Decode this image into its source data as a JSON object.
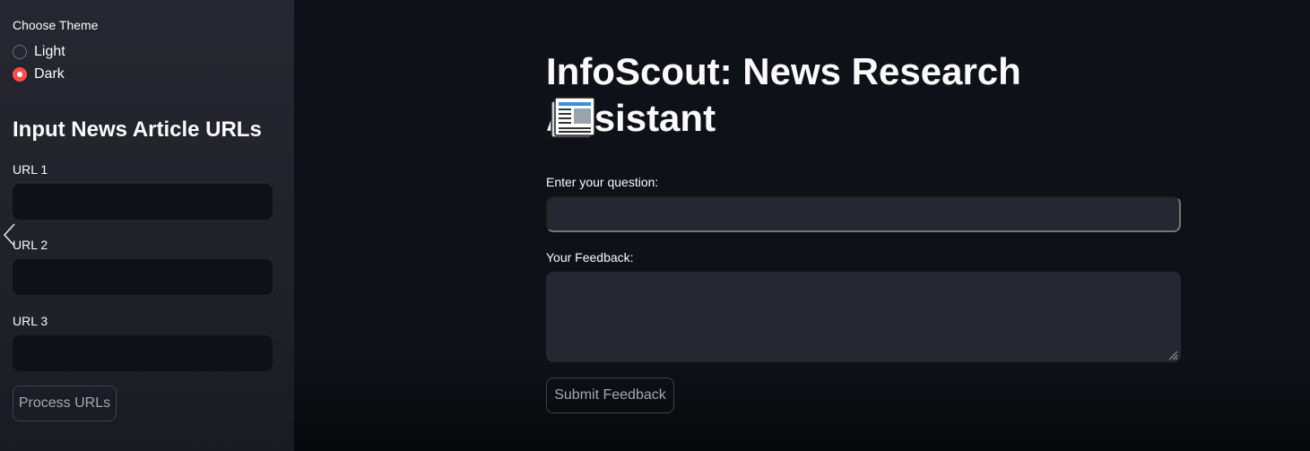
{
  "sidebar": {
    "theme_label": "Choose Theme",
    "theme_options": [
      {
        "label": "Light",
        "selected": false
      },
      {
        "label": "Dark",
        "selected": true
      }
    ],
    "heading": "Input News Article URLs",
    "url_fields": [
      {
        "label": "URL 1",
        "value": ""
      },
      {
        "label": "URL 2",
        "value": ""
      },
      {
        "label": "URL 3",
        "value": ""
      }
    ],
    "process_button": "Process URLs"
  },
  "main": {
    "title": "InfoScout: News Research Assistant",
    "title_icon": "newspaper-icon",
    "question_label": "Enter your question:",
    "question_value": "",
    "feedback_label": "Your Feedback:",
    "feedback_value": "",
    "submit_button": "Submit Feedback"
  },
  "colors": {
    "accent": "#ff4b4b",
    "sidebar_bg": "#262730",
    "main_bg": "#0e1117",
    "input_bg": "#262730"
  }
}
